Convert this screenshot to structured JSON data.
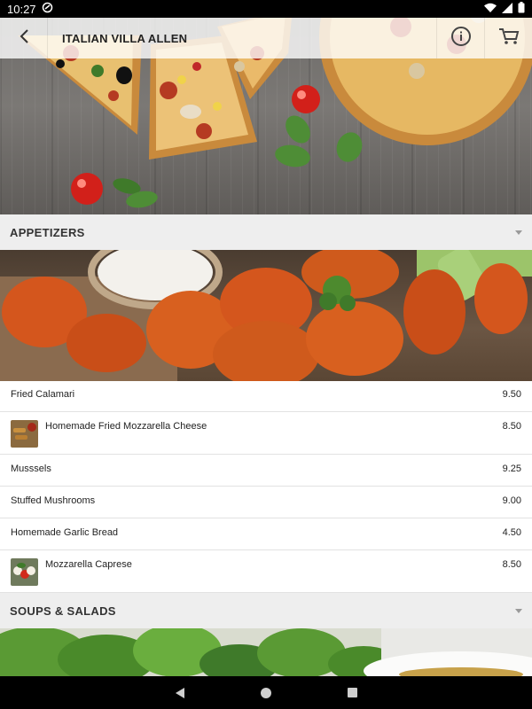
{
  "status_bar": {
    "time": "10:27",
    "icons": [
      "sync-icon",
      "wifi-icon",
      "signal-icon",
      "battery-icon"
    ]
  },
  "app_bar": {
    "title": "ITALIAN VILLA ALLEN",
    "icons": [
      "back-icon",
      "info-icon",
      "cart-icon"
    ]
  },
  "categories": [
    {
      "title": "APPETIZERS",
      "icon": "chevron-down-icon"
    },
    {
      "title": "SOUPS & SALADS",
      "icon": "chevron-down-icon"
    }
  ],
  "appetizers": [
    {
      "name": "Fried Calamari",
      "price": "9.50"
    },
    {
      "name": "Homemade Fried Mozzarella Cheese",
      "price": "8.50"
    },
    {
      "name": "Musssels",
      "price": "9.25"
    },
    {
      "name": "Stuffed Mushrooms",
      "price": "9.00"
    },
    {
      "name": "Homemade Garlic Bread",
      "price": "4.50"
    },
    {
      "name": "Mozzarella Caprese",
      "price": "8.50"
    }
  ],
  "nav_bar": {
    "icons": [
      "nav-back-icon",
      "nav-home-icon",
      "nav-recent-icon"
    ]
  }
}
